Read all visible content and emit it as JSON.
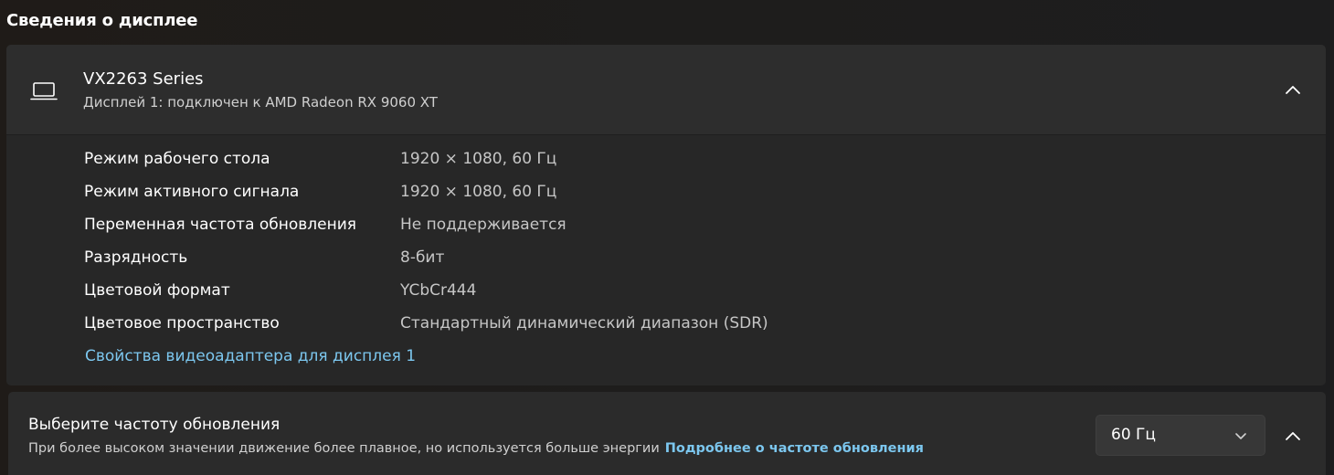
{
  "section_title": "Сведения о дисплее",
  "display": {
    "name": "VX2263 Series",
    "subtitle": "Дисплей 1: подключен к AMD Radeon RX 9060 XT",
    "icon": "laptop-icon",
    "expanded": true,
    "properties": [
      {
        "label": "Режим рабочего стола",
        "value": "1920 × 1080, 60 Гц"
      },
      {
        "label": "Режим активного сигнала",
        "value": "1920 × 1080, 60 Гц"
      },
      {
        "label": "Переменная частота обновления",
        "value": "Не поддерживается"
      },
      {
        "label": "Разрядность",
        "value": "8-бит"
      },
      {
        "label": "Цветовой формат",
        "value": "YCbCr444"
      },
      {
        "label": "Цветовое пространство",
        "value": "Стандартный динамический диапазон (SDR)"
      }
    ],
    "adapter_link": "Свойства видеоадаптера для дисплея 1"
  },
  "refresh": {
    "title": "Выберите частоту обновления",
    "description": "При более высоком значении движение более плавное, но используется больше энергии",
    "link": "Подробнее о частоте обновления",
    "selected_rate": "60 Гц",
    "expanded": true
  },
  "colors": {
    "accent_link": "#7cc7ef",
    "card_bg": "#272727",
    "header_bg": "#2d2d2d"
  }
}
